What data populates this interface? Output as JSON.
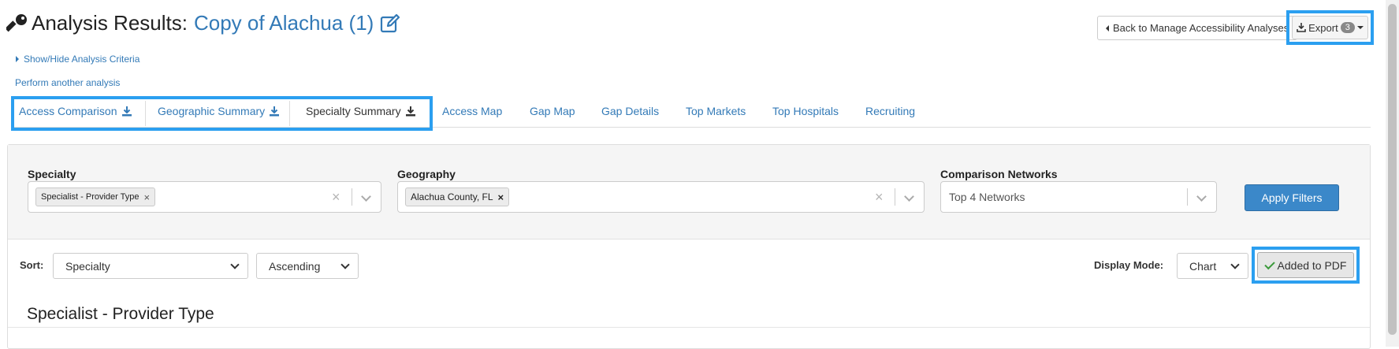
{
  "header": {
    "title_prefix": "Analysis Results:",
    "analysis_name": "Copy of Alachua (1)",
    "back_button": "Back to Manage Accessibility Analyses",
    "export_button": "Export",
    "export_count": "3"
  },
  "links": {
    "criteria_toggle": "Show/Hide Analysis Criteria",
    "perform_another": "Perform another analysis"
  },
  "tabs": [
    {
      "label": "Access Comparison",
      "download": true
    },
    {
      "label": "Geographic Summary",
      "download": true
    },
    {
      "label": "Specialty Summary",
      "download": true,
      "active": true
    },
    {
      "label": "Access Map"
    },
    {
      "label": "Gap Map"
    },
    {
      "label": "Gap Details"
    },
    {
      "label": "Top Markets"
    },
    {
      "label": "Top Hospitals"
    },
    {
      "label": "Recruiting"
    }
  ],
  "filters": {
    "specialty": {
      "label": "Specialty",
      "chip": "Specialist - Provider Type"
    },
    "geography": {
      "label": "Geography",
      "chip": "Alachua County, FL"
    },
    "networks": {
      "label": "Comparison Networks",
      "value": "Top 4 Networks"
    },
    "apply_button": "Apply Filters"
  },
  "sort": {
    "label": "Sort:",
    "field": "Specialty",
    "order": "Ascending"
  },
  "display": {
    "label": "Display Mode:",
    "mode": "Chart",
    "pdf_button": "Added to PDF"
  },
  "section": {
    "title": "Specialist - Provider Type"
  },
  "colors": {
    "link": "#337ab7",
    "highlight": "#2b9ff0",
    "primary_button": "#3b88c9"
  },
  "icons": [
    "key-icon",
    "edit-icon",
    "download-icon",
    "check-icon",
    "chevron-down-icon",
    "clear-icon"
  ]
}
